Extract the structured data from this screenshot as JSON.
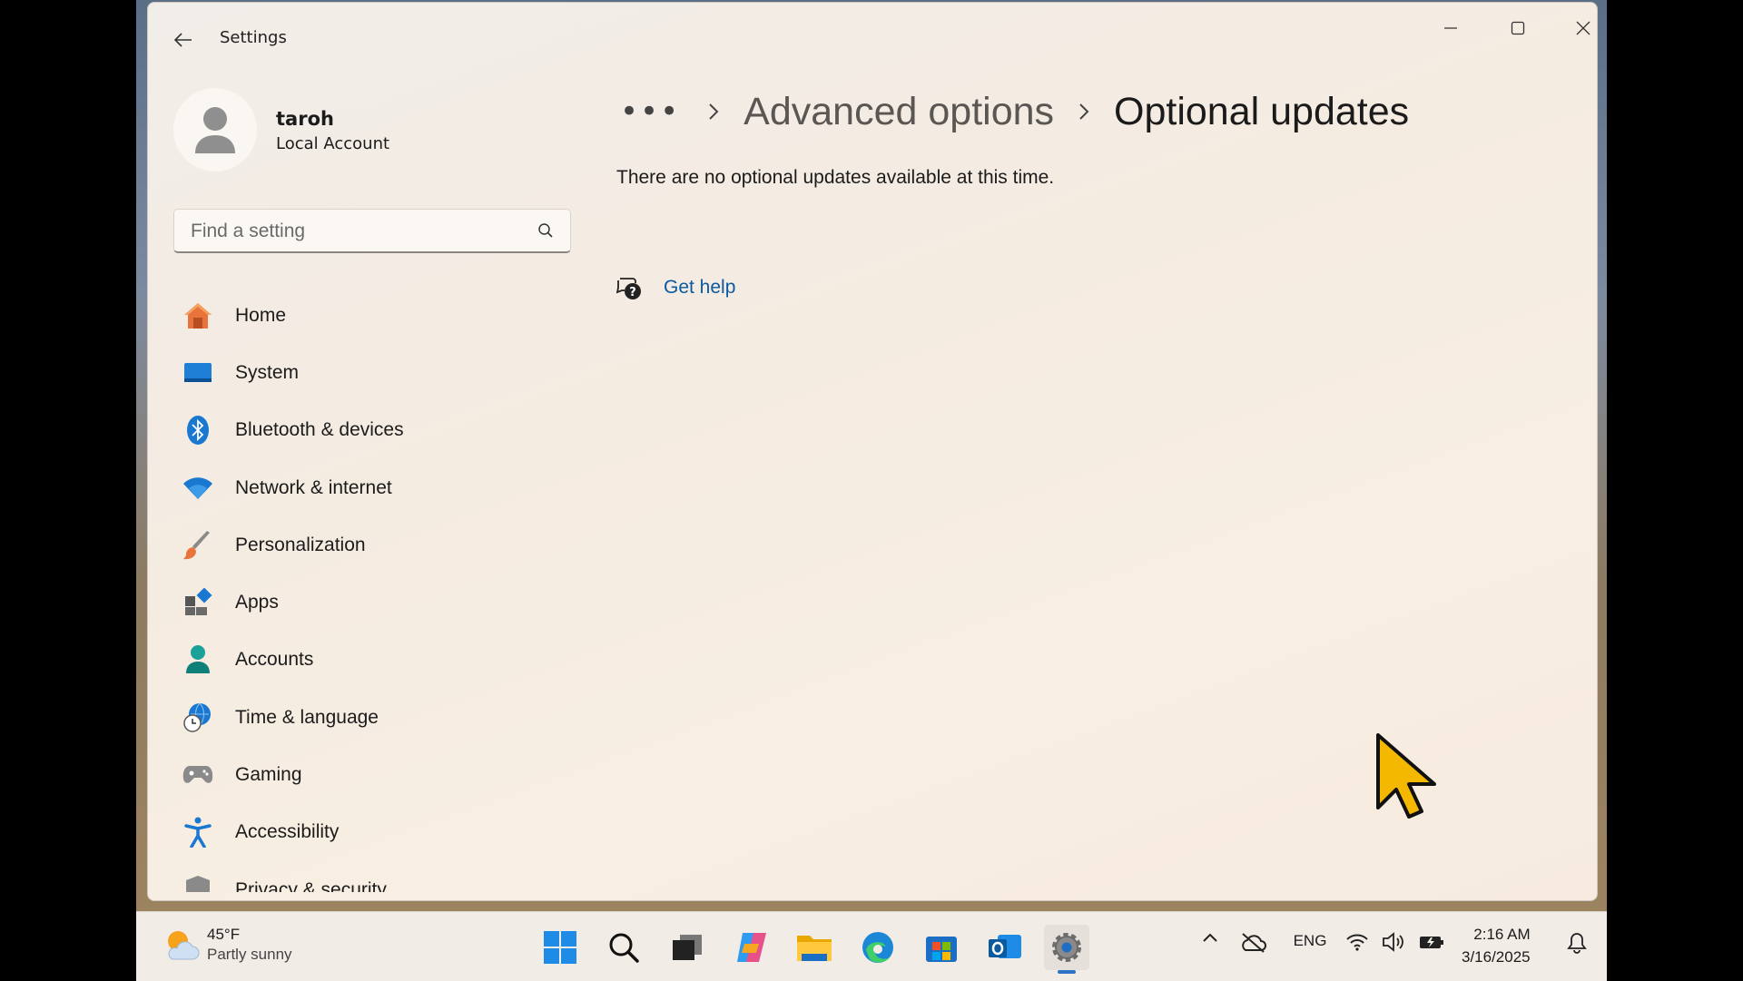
{
  "window": {
    "title": "Settings"
  },
  "profile": {
    "name": "taroh",
    "account_type": "Local Account"
  },
  "search": {
    "placeholder": "Find a setting"
  },
  "sidebar": {
    "items": [
      {
        "label": "Home",
        "icon": "home-icon"
      },
      {
        "label": "System",
        "icon": "system-icon"
      },
      {
        "label": "Bluetooth & devices",
        "icon": "bluetooth-icon"
      },
      {
        "label": "Network & internet",
        "icon": "wifi-icon"
      },
      {
        "label": "Personalization",
        "icon": "brush-icon"
      },
      {
        "label": "Apps",
        "icon": "apps-icon"
      },
      {
        "label": "Accounts",
        "icon": "accounts-icon"
      },
      {
        "label": "Time & language",
        "icon": "globe-clock-icon"
      },
      {
        "label": "Gaming",
        "icon": "gamepad-icon"
      },
      {
        "label": "Accessibility",
        "icon": "accessibility-icon"
      },
      {
        "label": "Privacy & security",
        "icon": "shield-icon"
      }
    ]
  },
  "breadcrumb": {
    "more": "•••",
    "parent": "Advanced options",
    "current": "Optional updates"
  },
  "main": {
    "message": "There are no optional updates available at this time.",
    "get_help": "Get help"
  },
  "taskbar": {
    "weather": {
      "temp": "45°F",
      "condition": "Partly sunny"
    },
    "apps": [
      "start",
      "search",
      "task-view",
      "copilot",
      "file-explorer",
      "edge",
      "store",
      "outlook",
      "settings"
    ],
    "active_app": "settings",
    "tray": {
      "language": "ENG"
    },
    "clock": {
      "time": "2:16 AM",
      "date": "3/16/2025"
    }
  },
  "colors": {
    "accent": "#0a5aa0",
    "link": "#0a5aa0",
    "window_bg": "#f5ece1"
  }
}
